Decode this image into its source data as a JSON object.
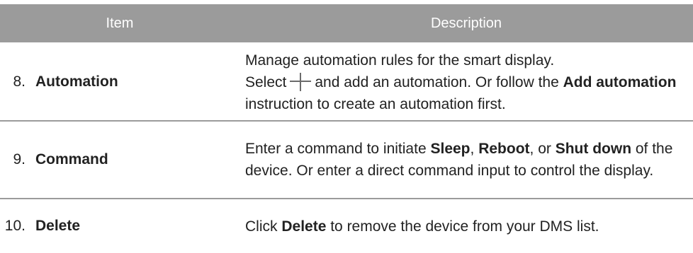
{
  "table": {
    "header": {
      "item": "Item",
      "description": "Description"
    },
    "rows": [
      {
        "number": "8.",
        "name": "Automation",
        "desc": {
          "line1": "Manage automation rules for the smart display.",
          "select": "Select",
          "after_icon": "and add an automation. Or follow the",
          "add_automation": "Add automation",
          "tail": "instruction to create an automation first."
        }
      },
      {
        "number": "9.",
        "name": "Command",
        "desc": {
          "intro": "Enter a command to initiate",
          "sleep": "Sleep",
          "comma": ",",
          "reboot": "Reboot",
          "or": ", or",
          "shut_down": "Shut down",
          "tail": "of the device. Or enter a direct command input to control the display."
        }
      },
      {
        "number": "10.",
        "name": "Delete",
        "desc": {
          "click": "Click",
          "delete": "Delete",
          "tail": "to remove the device from your DMS list."
        }
      }
    ]
  },
  "icons": {
    "add": "plus-icon"
  },
  "colors": {
    "header_bg": "#9b9b9b",
    "header_text": "#ffffff",
    "divider": "#9b9b9b"
  }
}
